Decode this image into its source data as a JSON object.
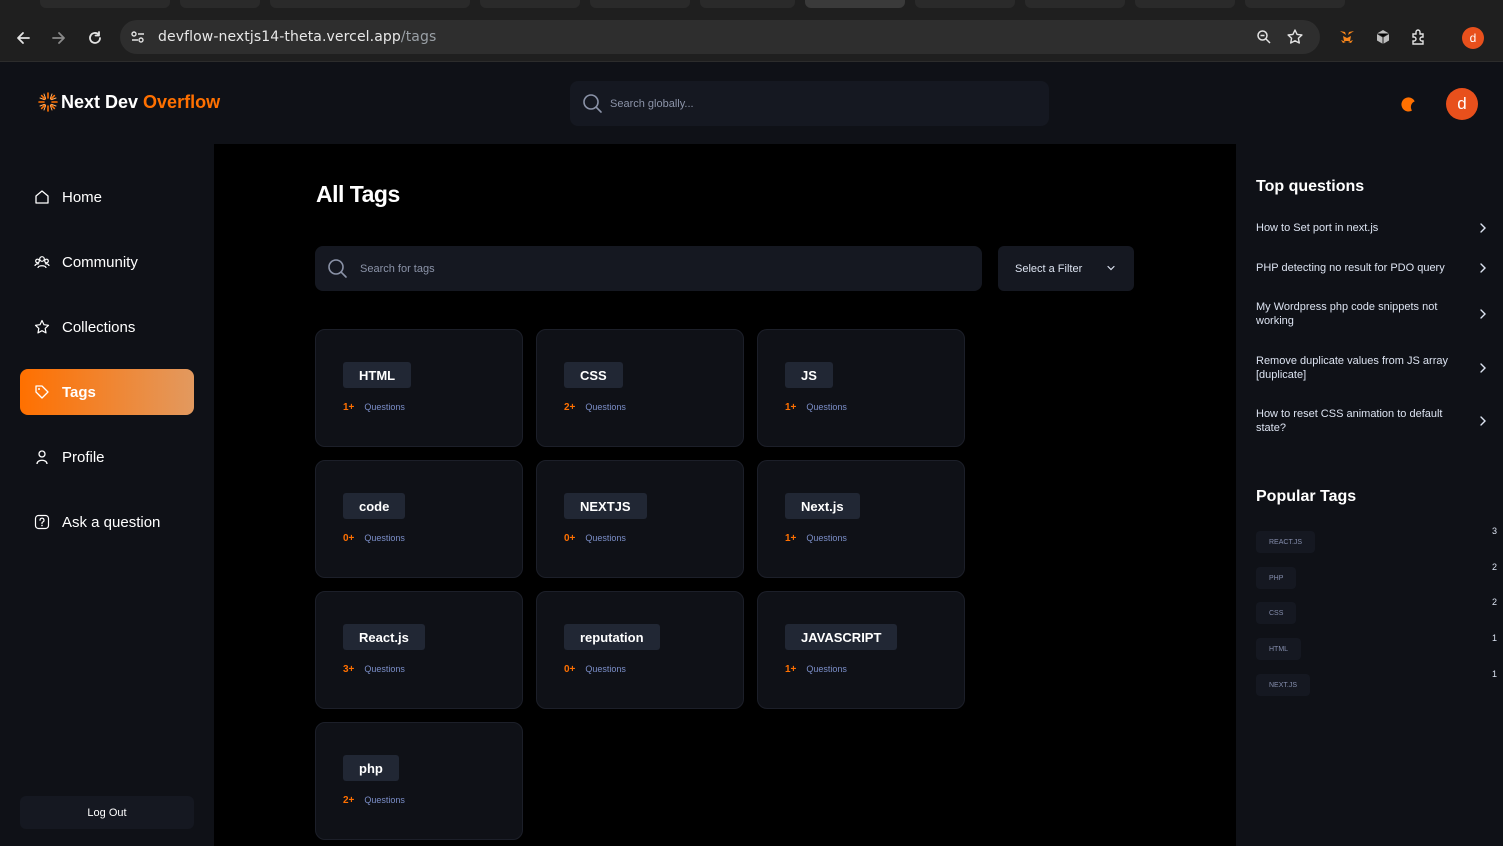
{
  "browser": {
    "url_host": "devflow-nextjs14-theta.vercel.app",
    "url_path": "/tags",
    "profile_initial": "d"
  },
  "header": {
    "logo_part1": "Next Dev",
    "logo_part2": "Overflow",
    "search_placeholder": "Search globally...",
    "avatar_initial": "d"
  },
  "sidebar": {
    "items": [
      {
        "label": "Home",
        "icon": "home-icon"
      },
      {
        "label": "Community",
        "icon": "users-icon"
      },
      {
        "label": "Collections",
        "icon": "star-icon"
      },
      {
        "label": "Tags",
        "icon": "tag-icon",
        "active": true
      },
      {
        "label": "Profile",
        "icon": "user-icon"
      },
      {
        "label": "Ask a question",
        "icon": "question-icon"
      }
    ],
    "logout_label": "Log Out"
  },
  "main": {
    "title": "All Tags",
    "search_placeholder": "Search for tags",
    "filter_label": "Select a Filter",
    "tags": [
      {
        "name": "HTML",
        "count": "1+",
        "label": "Questions"
      },
      {
        "name": "CSS",
        "count": "2+",
        "label": "Questions"
      },
      {
        "name": "JS",
        "count": "1+",
        "label": "Questions"
      },
      {
        "name": "code",
        "count": "0+",
        "label": "Questions"
      },
      {
        "name": "NEXTJS",
        "count": "0+",
        "label": "Questions"
      },
      {
        "name": "Next.js",
        "count": "1+",
        "label": "Questions"
      },
      {
        "name": "React.js",
        "count": "3+",
        "label": "Questions"
      },
      {
        "name": "reputation",
        "count": "0+",
        "label": "Questions"
      },
      {
        "name": "JAVASCRIPT",
        "count": "1+",
        "label": "Questions"
      },
      {
        "name": "php",
        "count": "2+",
        "label": "Questions"
      }
    ]
  },
  "rightbar": {
    "top_questions_title": "Top questions",
    "top_questions": [
      "How to Set port in next.js",
      "PHP detecting no result for PDO query",
      "My Wordpress php code snippets not working",
      "Remove duplicate values from JS array [duplicate]",
      "How to reset CSS animation to default state?"
    ],
    "popular_tags_title": "Popular Tags",
    "popular_tags": [
      {
        "name": "REACT.JS",
        "count": "3"
      },
      {
        "name": "PHP",
        "count": "2"
      },
      {
        "name": "CSS",
        "count": "2"
      },
      {
        "name": "HTML",
        "count": "1"
      },
      {
        "name": "NEXT.JS",
        "count": "1"
      }
    ]
  },
  "colors": {
    "accent": "#ff7000",
    "background": "#000000",
    "surface": "#0f1117",
    "pill": "#212734"
  }
}
